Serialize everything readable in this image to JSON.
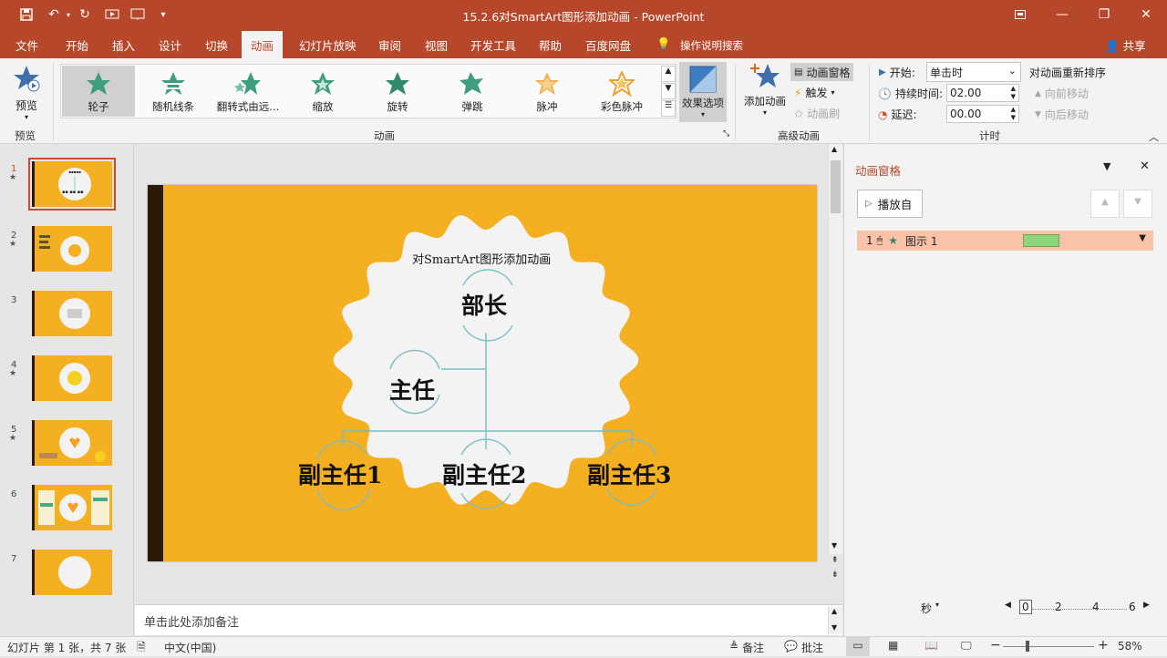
{
  "window": {
    "title": "15.2.6对SmartArt图形添加动画 - PowerPoint"
  },
  "tabs": [
    "文件",
    "开始",
    "插入",
    "设计",
    "切换",
    "动画",
    "幻灯片放映",
    "审阅",
    "视图",
    "开发工具",
    "帮助",
    "百度网盘"
  ],
  "active_tab": "动画",
  "tell_me": "操作说明搜索",
  "share": "共享",
  "ribbon": {
    "preview": {
      "label": "预览",
      "group": "预览"
    },
    "gallery": {
      "group": "动画",
      "items": [
        "轮子",
        "随机线条",
        "翻转式由远...",
        "缩放",
        "旋转",
        "弹跳",
        "脉冲",
        "彩色脉冲"
      ],
      "selected": "轮子",
      "effect_options": "效果选项"
    },
    "advanced": {
      "group": "高级动画",
      "add_animation": "添加动画",
      "animation_pane": "动画窗格",
      "trigger": "触发",
      "painter": "动画刷"
    },
    "timing": {
      "group": "计时",
      "start_label": "开始:",
      "start_value": "单击时",
      "duration_label": "持续时间:",
      "duration_value": "02.00",
      "delay_label": "延迟:",
      "delay_value": "00.00",
      "reorder": "对动画重新排序",
      "move_earlier": "向前移动",
      "move_later": "向后移动"
    }
  },
  "slides": {
    "count": 7,
    "selected": 1
  },
  "slide": {
    "title": "对SmartArt图形添加动画",
    "nodes": {
      "top": "部长",
      "middle": "主任",
      "left": "副主任1",
      "center": "副主任2",
      "right": "副主任3"
    }
  },
  "notes_placeholder": "单击此处添加备注",
  "anim_pane": {
    "title": "动画窗格",
    "play_from": "播放自",
    "item": {
      "index": "1",
      "name": "图示 1"
    },
    "unit": "秒",
    "timeline": [
      "0",
      "2",
      "4",
      "6"
    ]
  },
  "status": {
    "slide_info": "幻灯片 第 1 张，共 7 张",
    "language": "中文(中国)",
    "notes": "备注",
    "comments": "批注",
    "zoom": "58%"
  },
  "colors": {
    "accent": "#b7472a",
    "slide_bg": "#f5b021",
    "bar": "#2a1a06"
  }
}
